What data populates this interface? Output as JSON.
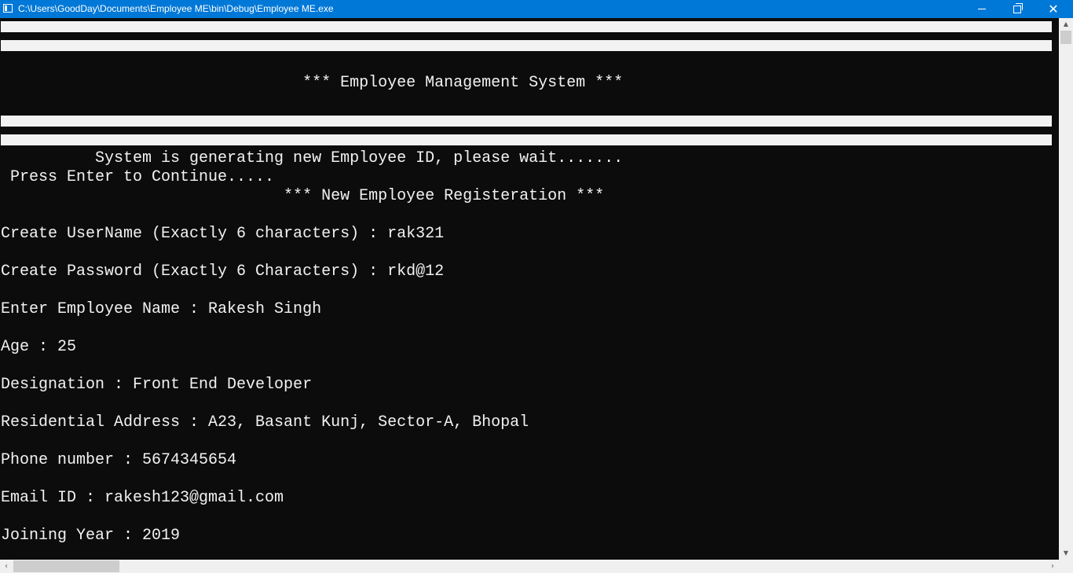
{
  "window": {
    "title": "C:\\Users\\GoodDay\\Documents\\Employee ME\\bin\\Debug\\Employee ME.exe",
    "controls": {
      "minimize_icon": "minimize-icon",
      "maximize_icon": "restore-icon",
      "close_glyph": "✕"
    }
  },
  "console": {
    "header_title": "                                *** Employee Management System ***",
    "generating_msg": "          System is generating new Employee ID, please wait.......",
    "press_enter": " Press Enter to Continue.....",
    "registration_title": "                              *** New Employee Registeration ***",
    "fields": [
      "Create UserName (Exactly 6 characters) : rak321",
      "Create Password (Exactly 6 Characters) : rkd@12",
      "Enter Employee Name : Rakesh Singh",
      "Age : 25",
      "Designation : Front End Developer",
      "Residential Address : A23, Basant Kunj, Sector-A, Bhopal",
      "Phone number : 5674345654",
      "Email ID : rakesh123@gmail.com",
      "Joining Year : 2019"
    ]
  },
  "scrollbars": {
    "up_glyph": "▲",
    "down_glyph": "▼",
    "left_glyph": "‹",
    "right_glyph": "›"
  },
  "colors": {
    "titlebar": "#0078d7",
    "console_bg": "#0c0c0c",
    "console_text": "#f2f2f2"
  }
}
